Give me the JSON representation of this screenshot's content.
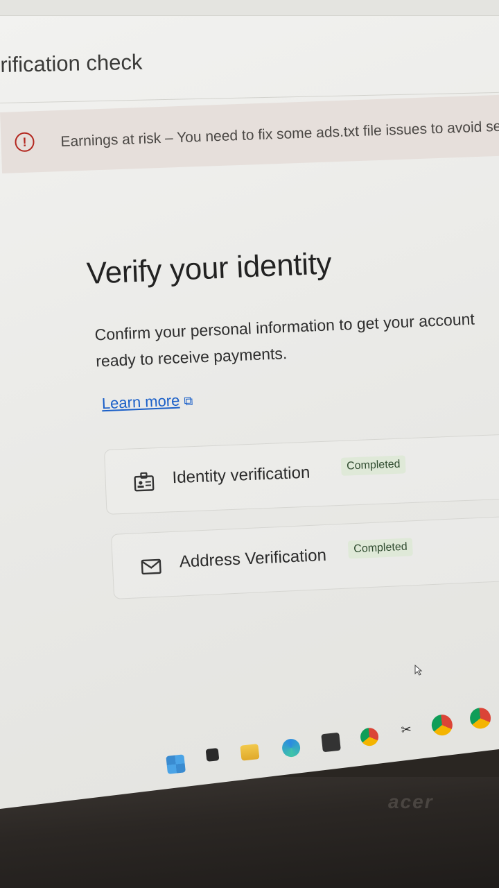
{
  "page": {
    "heading": "rification check"
  },
  "alert": {
    "icon": "error-circle-icon",
    "text": "Earnings at risk – You need to fix some ads.txt file issues to avoid seve",
    "color": "#b3261e"
  },
  "verify": {
    "title": "Verify your identity",
    "description": "Confirm your personal information to get your account ready to receive payments.",
    "learn_more_label": "Learn more",
    "learn_more_icon": "open-in-new-icon"
  },
  "steps": [
    {
      "label": "Identity verification",
      "status": "Completed",
      "icon": "id-badge-icon"
    },
    {
      "label": "Address Verification",
      "status": "Completed",
      "icon": "mail-icon"
    }
  ],
  "taskbar": {
    "icons": [
      "windows-start-icon",
      "task-view-icon",
      "file-explorer-icon",
      "edge-icon",
      "store-icon",
      "chrome-icon",
      "capcut-icon",
      "chrome-profile-icon",
      "chrome-profile-2-icon"
    ]
  },
  "colors": {
    "link": "#1a5fc8",
    "badge_bg": "#dfe9d8",
    "alert_bg": "#e6dfdb"
  }
}
